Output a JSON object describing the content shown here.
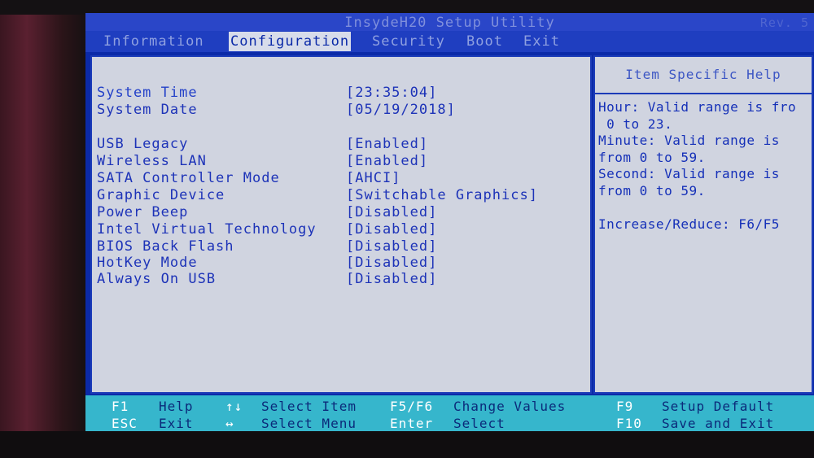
{
  "window": {
    "title": "InsydeH20 Setup Utility",
    "revision": "Rev. 5"
  },
  "menu": {
    "tabs": [
      {
        "label": "Information"
      },
      {
        "label": "Configuration"
      },
      {
        "label": "Security"
      },
      {
        "label": "Boot"
      },
      {
        "label": "Exit"
      }
    ],
    "active": "Configuration"
  },
  "settings": [
    {
      "label": "System Time",
      "value": "[23:35:04]"
    },
    {
      "label": "System Date",
      "value": "[05/19/2018]"
    },
    {
      "label": "USB Legacy",
      "value": "[Enabled]"
    },
    {
      "label": "Wireless LAN",
      "value": "[Enabled]"
    },
    {
      "label": "SATA Controller Mode",
      "value": "[AHCI]"
    },
    {
      "label": "Graphic Device",
      "value": "[Switchable Graphics]"
    },
    {
      "label": "Power Beep",
      "value": "[Disabled]"
    },
    {
      "label": "Intel Virtual Technology",
      "value": "[Disabled]"
    },
    {
      "label": "BIOS Back Flash",
      "value": "[Disabled]"
    },
    {
      "label": "HotKey Mode",
      "value": "[Disabled]"
    },
    {
      "label": "Always On USB",
      "value": "[Disabled]"
    }
  ],
  "help": {
    "title": "Item Specific Help",
    "lines": [
      "Hour: Valid range is fro",
      " 0 to 23.",
      "Minute: Valid range is",
      "from 0 to 59.",
      "Second: Valid range is",
      "from 0 to 59.",
      "",
      "Increase/Reduce: F6/F5"
    ]
  },
  "footer": {
    "keys": [
      {
        "key": "F1",
        "desc": "Help"
      },
      {
        "key": "ESC",
        "desc": "Exit"
      },
      {
        "key": "↑↓",
        "desc": "Select Item"
      },
      {
        "key": "↔",
        "desc": "Select Menu"
      },
      {
        "key": "F5/F6",
        "desc": "Change Values"
      },
      {
        "key": "Enter",
        "desc": "Select"
      },
      {
        "key": "F9",
        "desc": "Setup Default"
      },
      {
        "key": "F10",
        "desc": "Save and Exit"
      }
    ]
  },
  "colors": {
    "screen_bg": "#0b2aa8",
    "panel_bg": "#d0d4e0",
    "text_blue": "#1d33b8",
    "footer_bg": "#36b6cc"
  }
}
